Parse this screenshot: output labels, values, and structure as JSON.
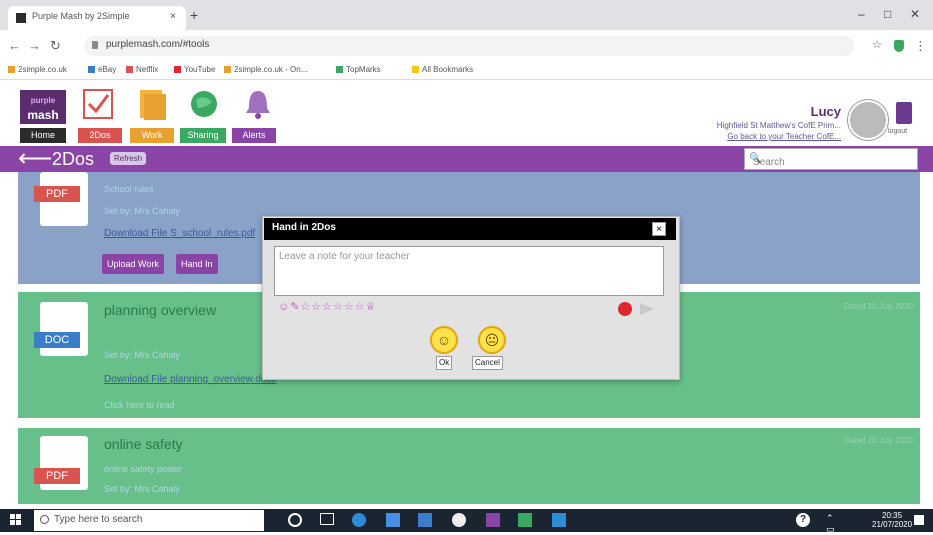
{
  "browser": {
    "tab_title": "Purple Mash by 2Simple",
    "tab_close": "×",
    "new_tab": "+",
    "url": "purplemash.com/#tools",
    "bookmarks": [
      "2simple.co.uk",
      "eBay",
      "Netflix",
      "YouTube",
      "2simple.co.uk - On...",
      "TopMarks",
      "All Bookmarks"
    ]
  },
  "header": {
    "logo_top": "purple",
    "logo_bottom": "mash",
    "nav": [
      {
        "label": "Home",
        "color": "#2b2b2b"
      },
      {
        "label": "2Dos",
        "color": "#d9534f"
      },
      {
        "label": "Work",
        "color": "#e8a030"
      },
      {
        "label": "Sharing",
        "color": "#3aa860"
      },
      {
        "label": "Alerts",
        "color": "#8a44a6"
      }
    ],
    "user_name": "Lucy",
    "school": "Highfield St Matthew's CofE Prim...",
    "go_back": "Go back to your Teacher CofE...",
    "logout_label": "logout"
  },
  "toolbar": {
    "page_title": "2Dos",
    "refresh_label": "Refresh",
    "search_placeholder": "Search"
  },
  "cards": [
    {
      "file_type": "PDF",
      "file_color": "#d9534f",
      "title": "",
      "subtitle": "School rules",
      "set_by": "Set by: Mrs Cahaly",
      "link": "Download File S_school_rules.pdf",
      "upload_label": "Upload Work",
      "handin_label": "Hand In",
      "dated": ""
    },
    {
      "file_type": "DOC",
      "file_color": "#3b7ec8",
      "title": "planning overview",
      "subtitle": "",
      "set_by": "Set by: Mrs Cahaly",
      "link": "Download File planning_overview.docx",
      "extra": "Click here to read",
      "dated": "Dated 20 July 2020"
    },
    {
      "file_type": "PDF",
      "file_color": "#d9534f",
      "title": "online safety",
      "subtitle": "online safety poster",
      "set_by": "Set by: Mrs Cahaly",
      "dated": "Dated 20 July 2020"
    }
  ],
  "modal": {
    "title": "Hand in 2Dos",
    "close": "×",
    "note_placeholder": "Leave a note for your teacher",
    "stickers": "☺✎☆☆☆☆☆☆♕",
    "ok_label": "Ok",
    "cancel_label": "Cancel"
  },
  "taskbar": {
    "search_placeholder": "Type here to search",
    "time": "20:35",
    "date": "21/07/2020"
  }
}
